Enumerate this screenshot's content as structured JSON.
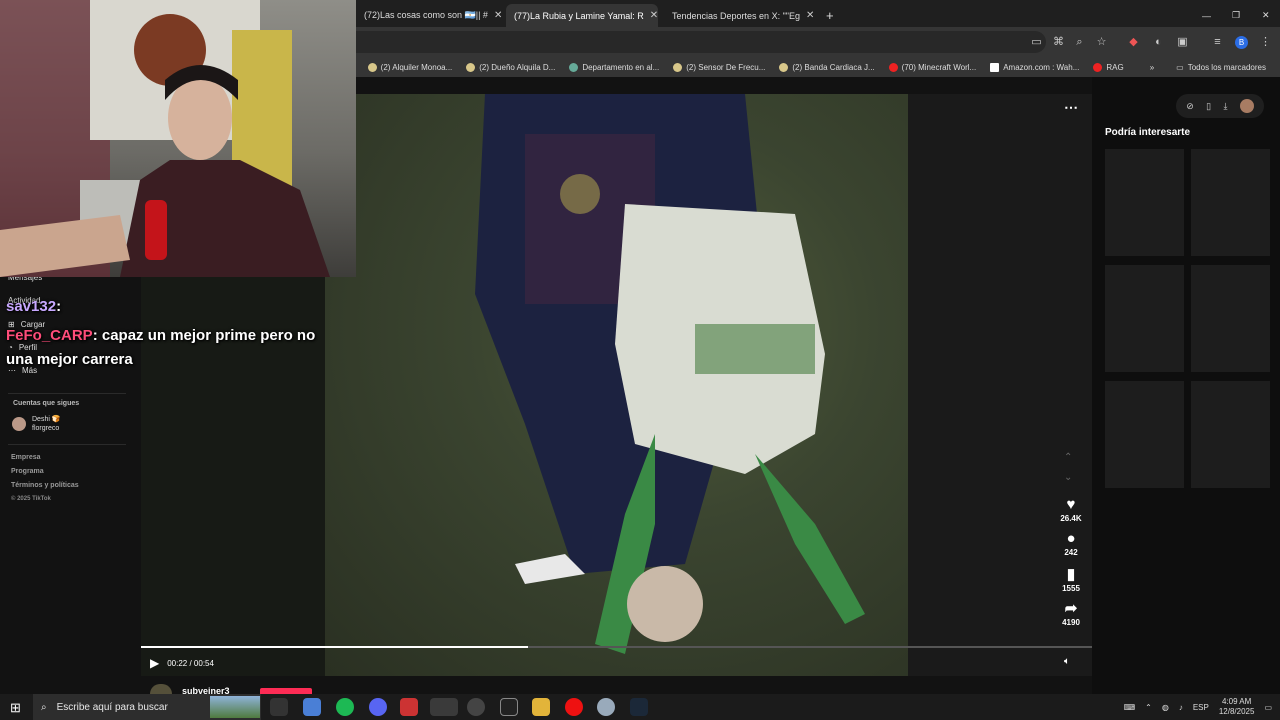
{
  "tabs": [
    {
      "label": "(72)Las cosas como son 🇦🇷|| #",
      "close": "✕"
    },
    {
      "label": "(77)La Rubia y Lamine Yamal: R",
      "close": "✕"
    },
    {
      "label": "Tendencias Deportes en X: \"\"Eg",
      "close": "✕"
    }
  ],
  "new_tab": "+",
  "window_controls": {
    "minimize": "—",
    "restore": "❐",
    "close": "✕"
  },
  "profile_initial": "B",
  "bookmarks": [
    "(2) Alquiler Monoa...",
    "(2) Dueño Alquila D...",
    "Departamento en al...",
    "(2) Sensor De Frecu...",
    "(2) Banda Cardiaca J...",
    "(70) Minecraft Worl...",
    "Amazon.com : Wah...",
    "RAG"
  ],
  "bookmarks_more": "»",
  "all_bookmarks": "Todos los marcadores",
  "sidebar": {
    "items": [
      "Mensajes",
      "Actividad",
      "Cargar",
      "Perfil",
      "Más"
    ],
    "following_title": "Cuentas que sigues",
    "following": [
      {
        "name": "Deshi 🍞",
        "handle": "florgreco"
      }
    ],
    "footer": [
      "Empresa",
      "Programa",
      "Términos y políticas",
      "© 2025 TikTok"
    ]
  },
  "chat": [
    {
      "user": "sav132",
      "text": ":"
    },
    {
      "user": "FeFo_CARP",
      "text": ": capaz un mejor prime pero no una mejor carrera"
    }
  ],
  "player": {
    "time": "00:22 / 00:54",
    "progress": 0.4074,
    "more": "⋯"
  },
  "actions": [
    {
      "icon": "heart-icon",
      "glyph": "♥",
      "count": "26.4K"
    },
    {
      "icon": "comment-icon",
      "glyph": "●",
      "count": "242"
    },
    {
      "icon": "bookmark-icon",
      "glyph": "▮",
      "count": "1555"
    },
    {
      "icon": "share-icon",
      "glyph": "➦",
      "count": "4190"
    }
  ],
  "author_partial": "subveiner3",
  "right_panel": {
    "title": "Podría interesarte"
  },
  "taskbar": {
    "search_placeholder": "Escribe aquí para buscar",
    "lang": "ESP",
    "time": "4:09 AM",
    "date": "12/8/2025"
  },
  "colors": {
    "accent": "#fe2c55",
    "chrome_bg": "#1f1f1f",
    "taskbar_bg": "#1b1b1b"
  }
}
